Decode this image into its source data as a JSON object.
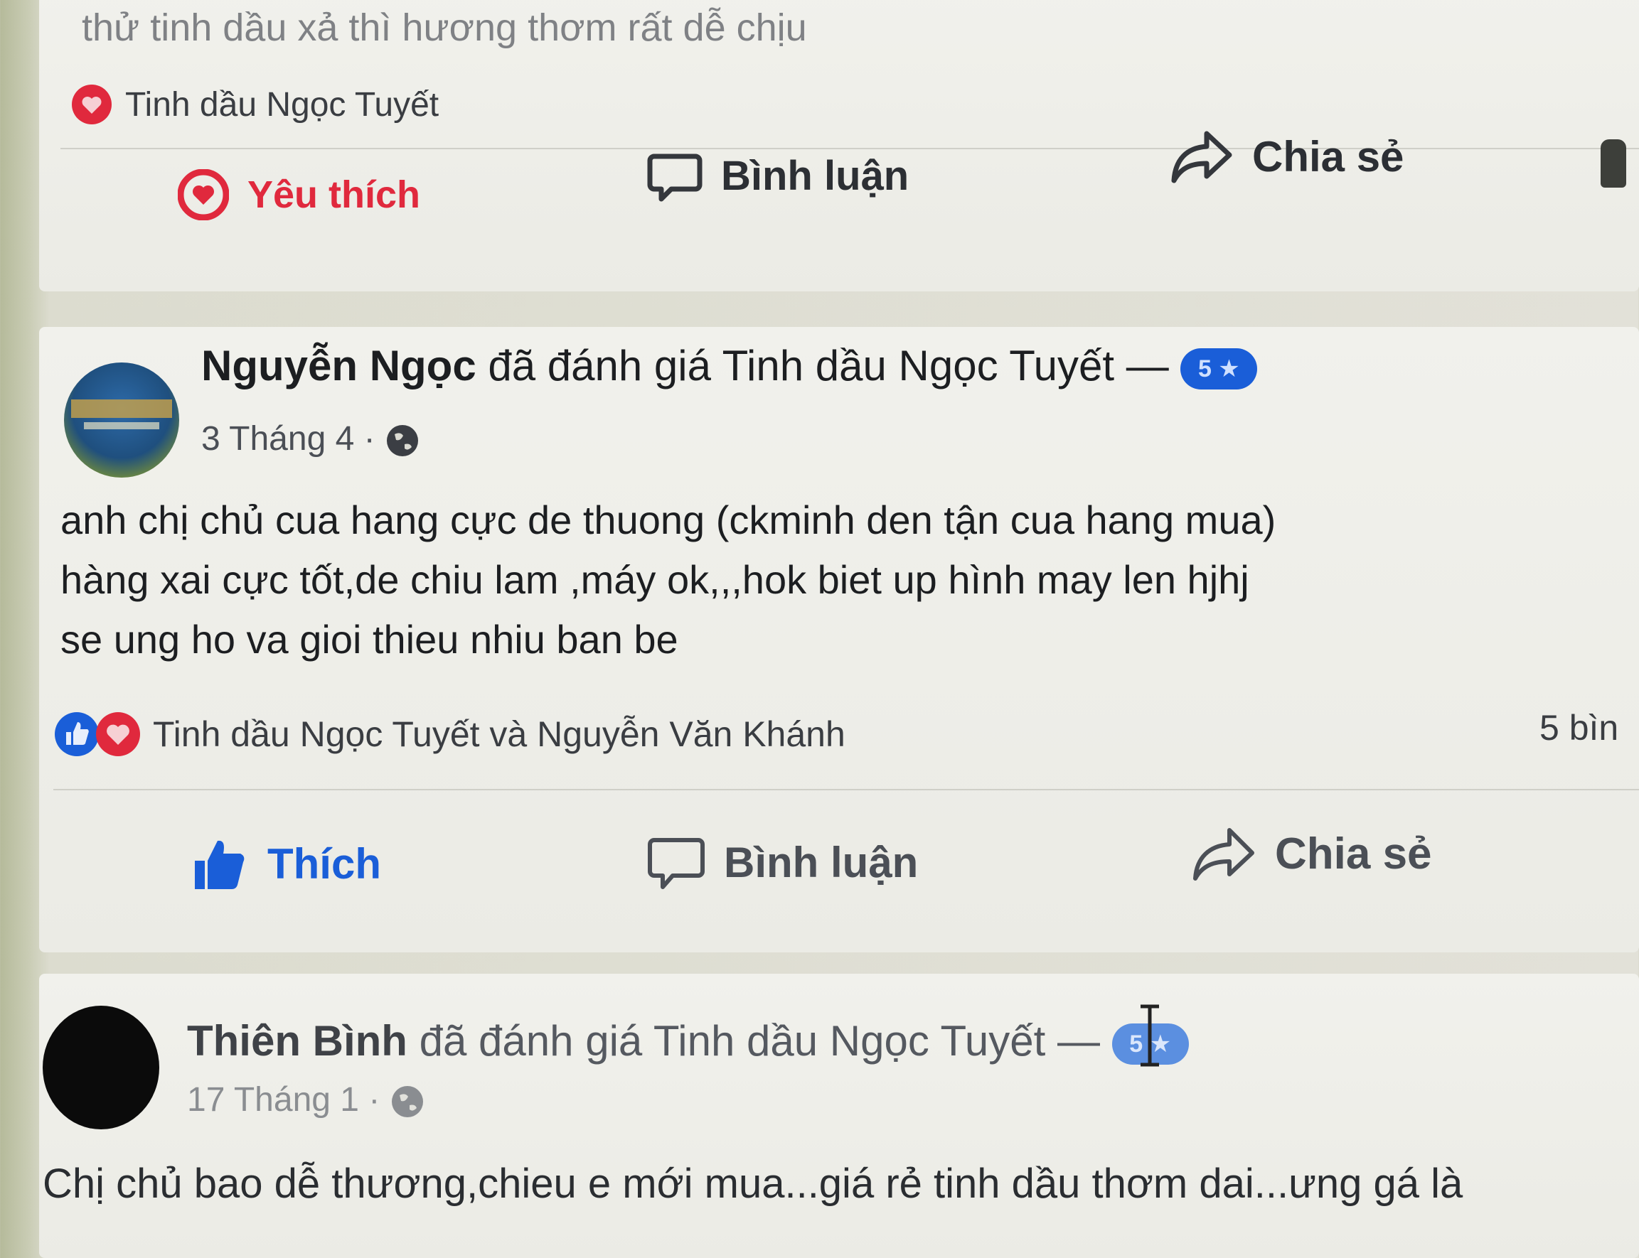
{
  "post1": {
    "text_partial": "thử tinh dầu xả thì hương thơm rất dễ chịu",
    "reactor": "Tinh dầu Ngọc Tuyết",
    "actions": {
      "love": "Yêu thích",
      "comment": "Bình luận",
      "share": "Chia sẻ"
    }
  },
  "post2": {
    "author": "Nguyễn Ngọc",
    "rated_text": "đã đánh giá",
    "page": "Tinh dầu Ngọc Tuyết",
    "separator": "—",
    "rating_badge": "5 ★",
    "date": "3 Tháng 4",
    "dot": "·",
    "body_lines": [
      "anh chị chủ cua hang cực de thuong (ckminh den tận cua hang mua)",
      "hàng xai cực tốt,de chiu lam ,máy ok,,,hok biet up hình may len hjhj",
      "se ung ho va gioi thieu nhiu ban be"
    ],
    "reactions": "Tinh dầu Ngọc Tuyết và Nguyễn Văn Khánh",
    "comment_count": "5 bìn",
    "actions": {
      "like": "Thích",
      "comment": "Bình luận",
      "share": "Chia sẻ"
    }
  },
  "post3": {
    "author": "Thiên Bình",
    "rated_text": "đã đánh giá",
    "page": "Tinh dầu Ngọc Tuyết",
    "separator": "—",
    "rating_badge": "5 ★",
    "date": "17 Tháng 1",
    "dot": "·",
    "body_partial": "Chị chủ bao dễ thương,chieu e mới mua...giá rẻ tinh dầu thơm dai...ưng gá là"
  },
  "colors": {
    "brand_blue": "#1a5ed8",
    "love_red": "#e0293d",
    "text_dark": "#1c1e21",
    "text_muted": "#4b4f56"
  }
}
